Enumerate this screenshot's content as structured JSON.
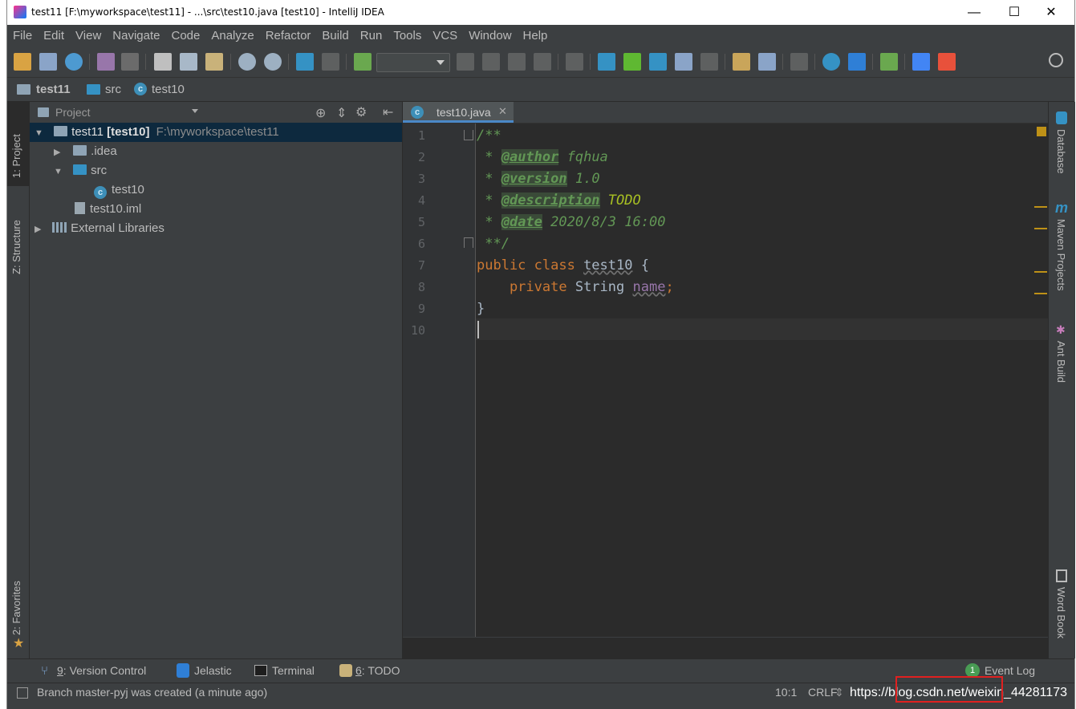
{
  "window": {
    "title": "test11 [F:\\myworkspace\\test11] - ...\\src\\test10.java [test10] - IntelliJ IDEA",
    "minimize_label": "—",
    "maximize_label": "☐",
    "close_label": "✕"
  },
  "menu": [
    "File",
    "Edit",
    "View",
    "Navigate",
    "Code",
    "Analyze",
    "Refactor",
    "Build",
    "Run",
    "Tools",
    "VCS",
    "Window",
    "Help"
  ],
  "breadcrumb": [
    "test11",
    "src",
    "test10"
  ],
  "left_tabs": {
    "project": "1: Project",
    "structure": "Z: Structure",
    "favorites": "2: Favorites"
  },
  "project_panel": {
    "title": "Project",
    "tree": [
      {
        "label": "test11",
        "module": "[test10]",
        "path": "F:\\myworkspace\\test11"
      },
      {
        "label": ".idea"
      },
      {
        "label": "src"
      },
      {
        "label": "test10"
      },
      {
        "label": "test10.iml"
      },
      {
        "label": "External Libraries"
      }
    ]
  },
  "editor": {
    "tab": "test10.java",
    "line_numbers": [
      "1",
      "2",
      "3",
      "4",
      "5",
      "6",
      "7",
      "8",
      "9",
      "10"
    ],
    "code": {
      "l1": "/**",
      "l2_prefix": " * ",
      "l2_tag": "@author",
      "l2_val": " fqhua",
      "l3_prefix": " * ",
      "l3_tag": "@version",
      "l3_val": " 1.0",
      "l4_prefix": " * ",
      "l4_tag": "@description",
      "l4_val": " TODO",
      "l5_prefix": " * ",
      "l5_tag": "@date",
      "l5_val": " 2020/8/3 16:00",
      "l6": " **/",
      "l7_kw": "public class ",
      "l7_name": "test10",
      "l7_rest": " {",
      "l8_kw": "    private ",
      "l8_type": "String ",
      "l8_name": "name",
      "l8_semi": ";",
      "l9": "}"
    }
  },
  "right_tabs": {
    "database": "Database",
    "maven": "Maven Projects",
    "ant": "Ant Build",
    "wordbook": "Word Book"
  },
  "bottom_tools": {
    "vcs_num": "9",
    "vcs": ": Version Control",
    "jelastic": "Jelastic",
    "terminal": "Terminal",
    "todo_num": "6",
    "todo": ": TODO",
    "event_log_count": "1",
    "event_log": "Event Log"
  },
  "status": {
    "message": "Branch master-pyj was created (a minute ago)",
    "position": "10:1",
    "line_sep": "CRLF",
    "watermark": "https://blog.csdn.net/weixin_44281173"
  }
}
